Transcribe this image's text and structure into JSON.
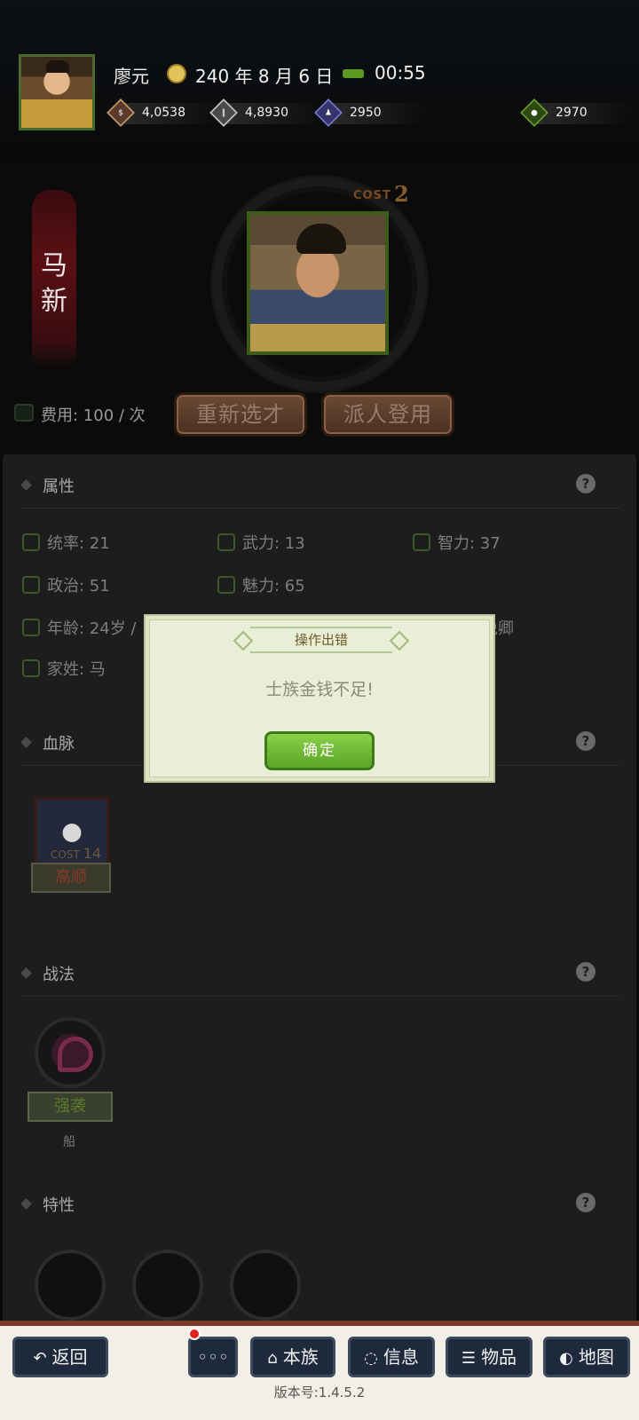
{
  "header": {
    "player_name": "廖元",
    "date": "240 年 8 月 6 日",
    "time": "00:55",
    "resources": [
      {
        "icon": "coin-icon",
        "value": "4,0538",
        "color": "#caa06a"
      },
      {
        "icon": "grain-icon",
        "value": "4,8930",
        "color": "#c9c9c9"
      },
      {
        "icon": "troops-icon",
        "value": "2950",
        "color": "#7a78d0"
      },
      {
        "icon": "money-bag-icon",
        "value": "2970",
        "color": "#6aa02a"
      }
    ]
  },
  "recruit": {
    "name": [
      "马",
      "新"
    ],
    "cost_label": "COST",
    "cost_value": "2",
    "fee": "费用: 100 / 次",
    "reselect_button": "重新选才",
    "dispatch_button": "派人登用"
  },
  "attributes": {
    "title": "属性",
    "command": "统率: 21",
    "force": "武力: 13",
    "intelligence": "智力: 37",
    "politics": "政治: 51",
    "charm": "魅力: 65",
    "age": "年龄: 24岁 /",
    "rank": "免卿",
    "surname": "家姓: 马"
  },
  "bloodline": {
    "title": "血脉",
    "unit_cost_label": "COST",
    "unit_cost": "14",
    "unit_name": "高顺"
  },
  "tactics": {
    "title": "战法",
    "skill_name": "强袭",
    "skill_sub": "船"
  },
  "traits": {
    "title": "特性"
  },
  "dialog": {
    "title": "操作出错",
    "message": "士族金钱不足!",
    "ok": "确定"
  },
  "bottom_nav": {
    "back": "返回",
    "more": "◦◦◦",
    "clan": "本族",
    "info": "信息",
    "items": "物品",
    "map": "地图"
  },
  "version": "版本号:1.4.5.2"
}
